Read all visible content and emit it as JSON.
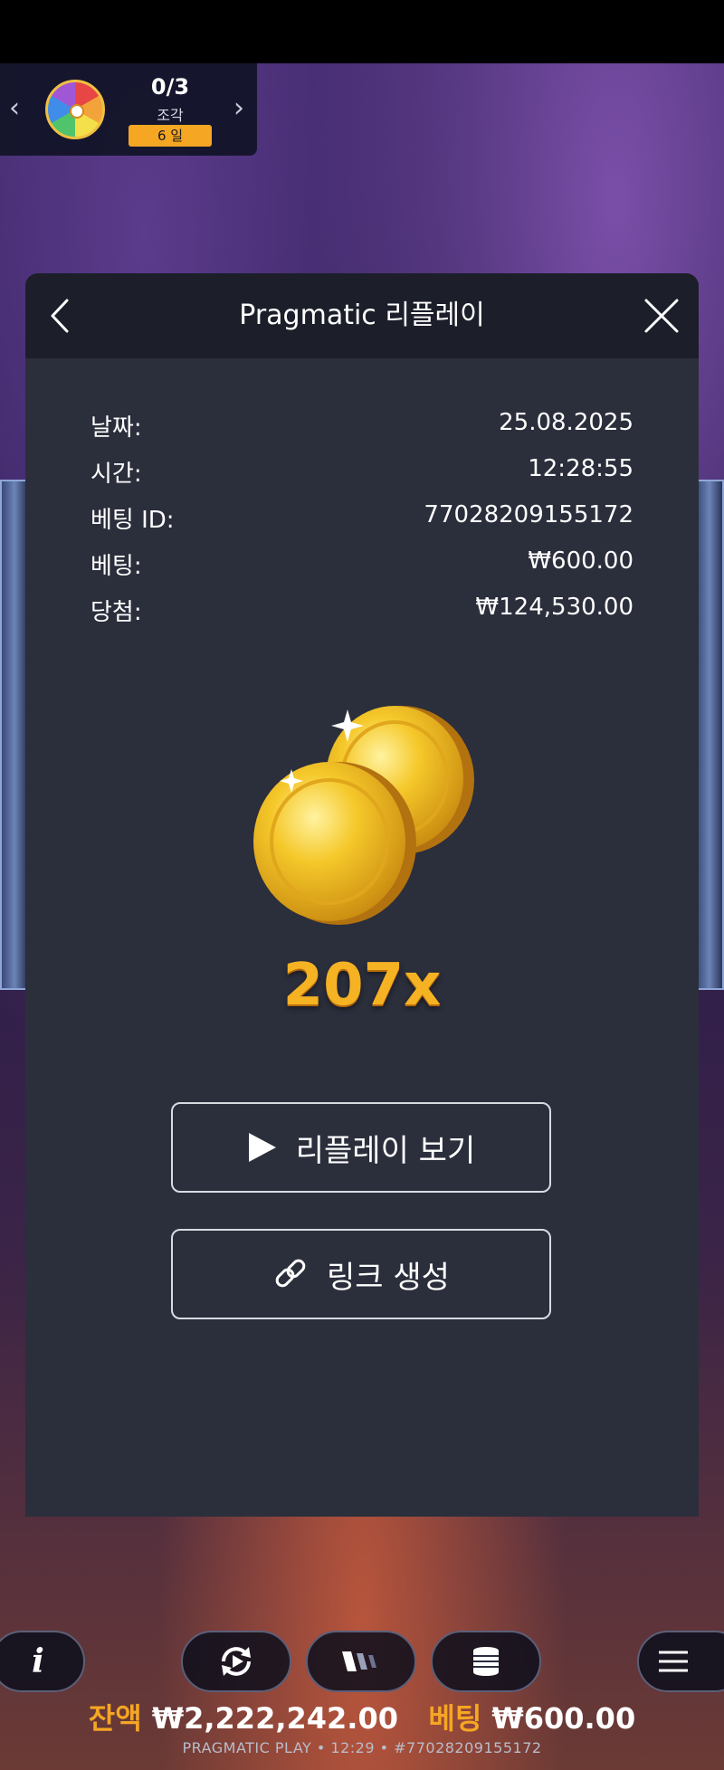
{
  "quest": {
    "count": "0/3",
    "label": "조각",
    "days": "6 일"
  },
  "modal": {
    "title": "Pragmatic 리플레이",
    "info": [
      {
        "key": "날짜:",
        "value": "25.08.2025"
      },
      {
        "key": "시간:",
        "value": "12:28:55"
      },
      {
        "key": "베팅 ID:",
        "value": "77028209155172"
      },
      {
        "key": "베팅:",
        "value": "₩600.00"
      },
      {
        "key": "당첨:",
        "value": "₩124,530.00"
      }
    ],
    "multiplier": "207x",
    "replay_button": "리플레이 보기",
    "link_button": "링크 생성"
  },
  "controls": {
    "balance_label": "잔액",
    "balance_value": "₩2,222,242.00",
    "bet_label": "베팅",
    "bet_value": "₩600.00",
    "footer": "PRAGMATIC PLAY • 12:29 • #77028209155172"
  },
  "colors": {
    "accent": "#f5a623",
    "modal_bg": "#2b2e3b",
    "header_bg": "#1c1f2a"
  }
}
